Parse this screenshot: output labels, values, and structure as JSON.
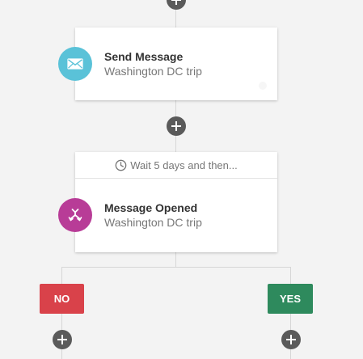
{
  "colors": {
    "send_icon_bg": "#5ac2d8",
    "opened_icon_bg": "#b83c97",
    "no_button": "#d9424a",
    "yes_button": "#2e8a5d",
    "plus_button": "#5a5a5a",
    "connector": "#d6d6d6"
  },
  "send_message_step": {
    "icon": "envelope-icon",
    "title": "Send Message",
    "subtitle": "Washington DC trip"
  },
  "wait_step": {
    "icon": "clock-icon",
    "label": "Wait 5 days and then..."
  },
  "message_opened_step": {
    "icon": "split-branch-icon",
    "title": "Message Opened",
    "subtitle": "Washington DC trip"
  },
  "branches": {
    "no_label": "NO",
    "yes_label": "YES"
  },
  "add_step_icon": "plus-icon"
}
